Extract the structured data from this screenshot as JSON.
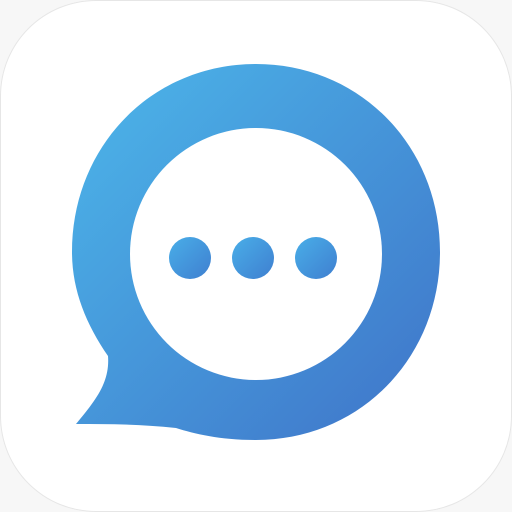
{
  "app_icon": {
    "icon": "chat-bubble-icon",
    "inner_icon": "ellipsis-icon",
    "colors": {
      "gradient_start": "#4cb7ea",
      "gradient_end": "#3f73c8",
      "background": "#ffffff",
      "bubble_inner": "#ffffff",
      "dots_start": "#49aee8",
      "dots_end": "#3f7fd0"
    }
  }
}
